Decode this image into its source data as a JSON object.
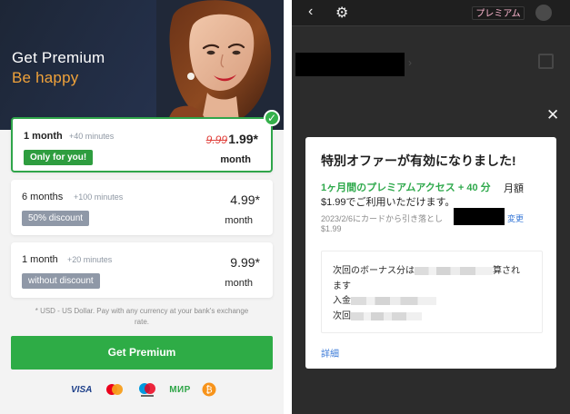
{
  "left_panel": {
    "hero": {
      "title": "Get Premium",
      "subtitle": "Be happy"
    },
    "plans": [
      {
        "duration": "1 month",
        "bonus": "+40 minutes",
        "badge": "Only for you!",
        "old_price": "9.99",
        "price": "1.99*",
        "unit": "month",
        "selected": true
      },
      {
        "duration": "6 months",
        "bonus": "+100 minutes",
        "badge": "50% discount",
        "price": "4.99*",
        "unit": "month",
        "selected": false
      },
      {
        "duration": "1 month",
        "bonus": "+20 minutes",
        "badge": "without discount",
        "price": "9.99*",
        "unit": "month",
        "selected": false
      }
    ],
    "currency_note_line1": "* USD - US Dollar. Pay with any currency at your bank's exchange",
    "currency_note_line2": "rate.",
    "cta_label": "Get Premium",
    "payment_methods": {
      "visa_label": "VISA",
      "mir_label": "МИР"
    },
    "accent_color": "#2eac46"
  },
  "right_panel": {
    "topbar": {
      "premium_badge": "プレミアム"
    },
    "modal": {
      "title": "特別オファーが有効になりました!",
      "offer_line": "1ヶ月間のプレミアムアクセス + 40 分",
      "offer_suffix": "月額",
      "price_line": "$1.99でご利用いただけます。",
      "charge_line_prefix": "2023/2/6にカードから引き落とし",
      "change_link": "変更",
      "charge_line_suffix": "$1.99",
      "bonus_line1_prefix": "次回のボーナス分は",
      "bonus_line1_suffix": "算され",
      "bonus_line2": "ます",
      "bonus_line3_prefix": "入金",
      "bonus_line4_prefix": "次回",
      "detail_link": "詳細"
    }
  }
}
